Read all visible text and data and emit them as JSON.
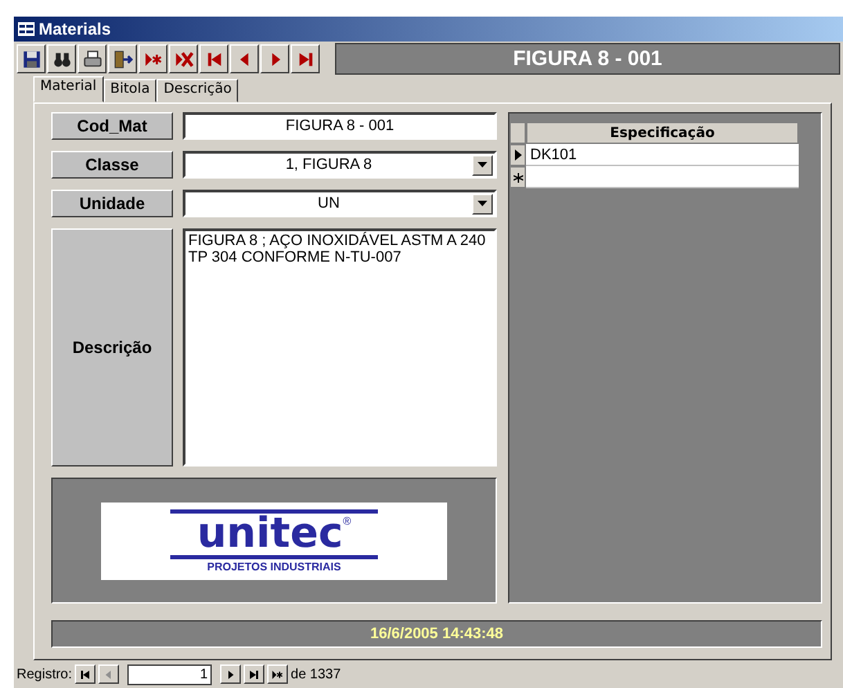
{
  "window": {
    "title": "Materials"
  },
  "toolbar": {
    "buttons": [
      {
        "kind": "save"
      },
      {
        "kind": "find"
      },
      {
        "kind": "print"
      },
      {
        "kind": "exit"
      },
      {
        "kind": "new"
      },
      {
        "kind": "delete"
      },
      {
        "kind": "first"
      },
      {
        "kind": "prev"
      },
      {
        "kind": "next"
      },
      {
        "kind": "last"
      }
    ],
    "record_title": "FIGURA 8 - 001"
  },
  "tabs": [
    {
      "label": "Material",
      "selected": true
    },
    {
      "label": "Bitola",
      "selected": false
    },
    {
      "label": "Descrição",
      "selected": false
    }
  ],
  "fields": [
    {
      "label": "Cod_Mat",
      "kind": "text",
      "value": "FIGURA 8 - 001"
    },
    {
      "label": "Classe",
      "kind": "combo",
      "value": "1, FIGURA 8"
    },
    {
      "label": "Unidade",
      "kind": "combo",
      "value": "UN"
    },
    {
      "label": "Descrição",
      "kind": "memo",
      "value": "FIGURA 8 ; AÇO INOXIDÁVEL ASTM A 240 TP 304 CONFORME N-TU-007"
    }
  ],
  "logo": {
    "name": "unitec",
    "mark": "®",
    "tagline": "PROJETOS INDUSTRIAIS"
  },
  "spec_grid": {
    "column": "Especificação",
    "rows": [
      {
        "value": "DK101",
        "selected": true
      }
    ]
  },
  "timestamp": "16/6/2005 14:43:48",
  "record_nav": {
    "label": "Registro:",
    "current": "1",
    "total": "de 1337",
    "buttons": [
      {
        "kind": "first",
        "disabled": false
      },
      {
        "kind": "prev",
        "disabled": true
      },
      {
        "kind": "next",
        "disabled": false
      },
      {
        "kind": "last",
        "disabled": false
      },
      {
        "kind": "new",
        "disabled": false
      }
    ]
  }
}
